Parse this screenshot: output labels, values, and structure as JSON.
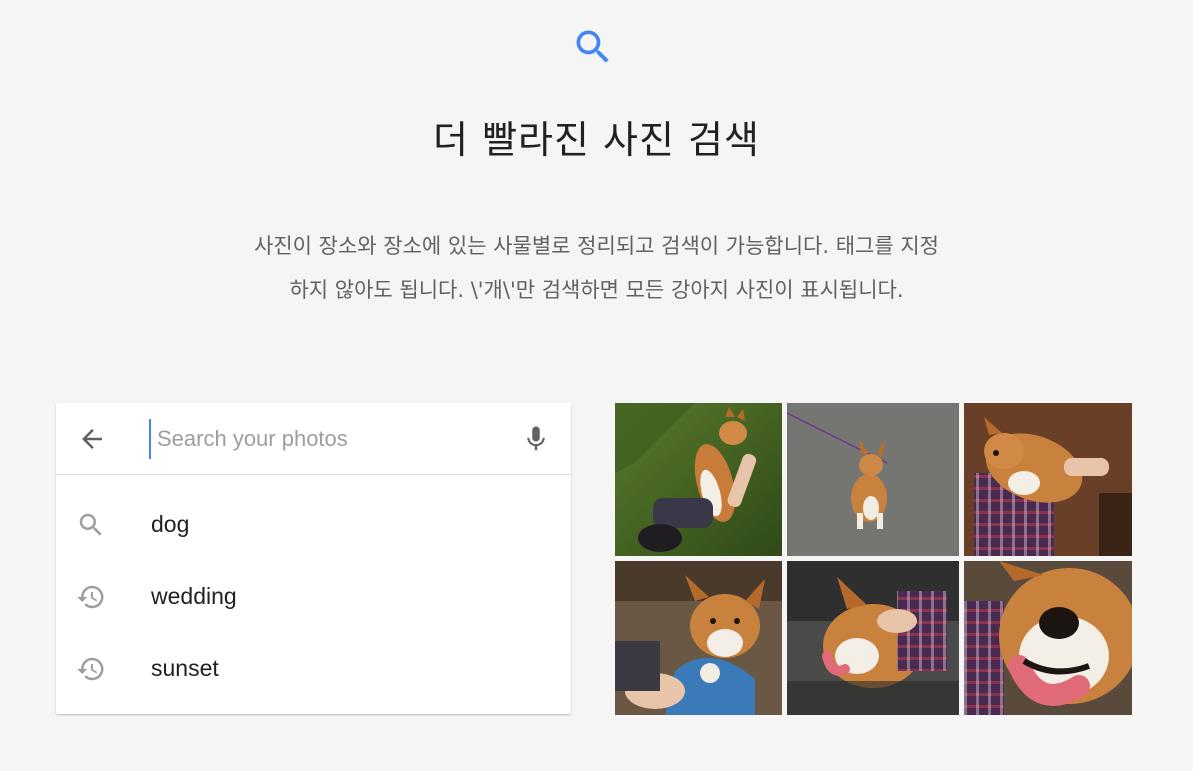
{
  "hero": {
    "icon": "search-icon",
    "title": "더 빨라진 사진 검색",
    "description_line1": "사진이 장소와 장소에 있는 사물별로 정리되고 검색이 가능합니다. 태그를 지정",
    "description_line2": "하지 않아도 됩니다. \\'개\\'만 검색하면 모든 강아지 사진이 표시됩니다."
  },
  "search": {
    "placeholder": "Search your photos",
    "value": "",
    "back_icon": "arrow-back-icon",
    "mic_icon": "microphone-icon",
    "suggestions": [
      {
        "icon": "search-icon",
        "label": "dog"
      },
      {
        "icon": "history-icon",
        "label": "wedding"
      },
      {
        "icon": "history-icon",
        "label": "sunset"
      }
    ]
  },
  "photos": [
    {
      "subject": "corgi-jumping-on-grass"
    },
    {
      "subject": "corgi-on-pavement"
    },
    {
      "subject": "corgi-held-in-arms"
    },
    {
      "subject": "corgi-with-toy"
    },
    {
      "subject": "corgi-being-petted"
    },
    {
      "subject": "corgi-closeup"
    }
  ],
  "colors": {
    "background": "#f5f5f5",
    "accent": "#4285f4",
    "icon_gray": "#757575",
    "text_primary": "#212121",
    "text_secondary": "#616161"
  }
}
